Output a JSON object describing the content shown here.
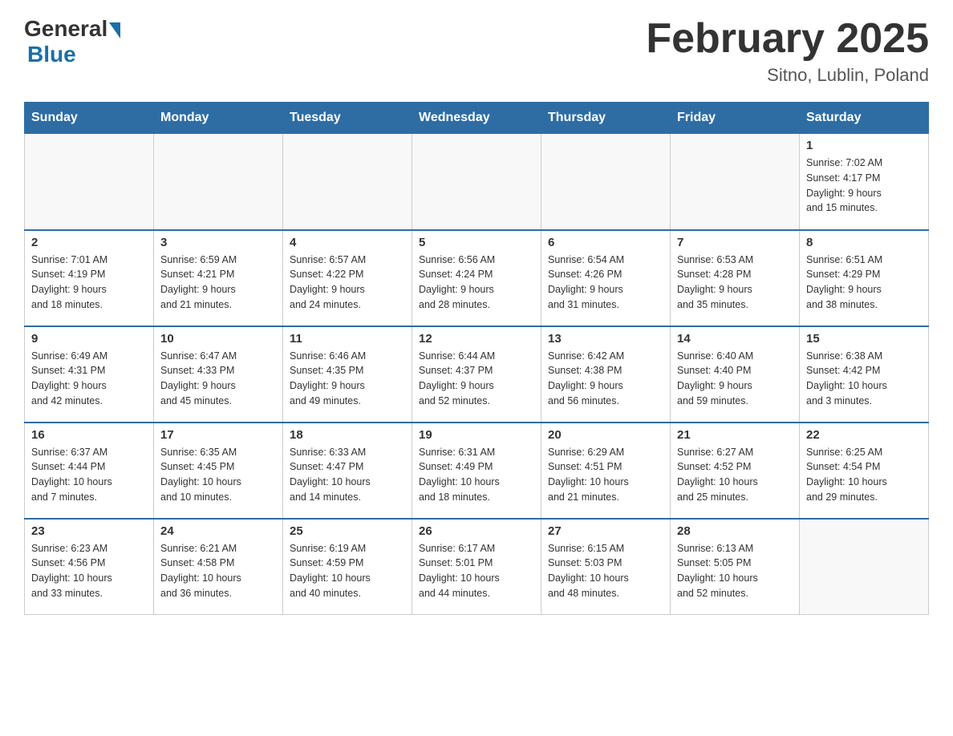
{
  "header": {
    "logo_general": "General",
    "logo_blue": "Blue",
    "title": "February 2025",
    "location": "Sitno, Lublin, Poland"
  },
  "weekdays": [
    "Sunday",
    "Monday",
    "Tuesday",
    "Wednesday",
    "Thursday",
    "Friday",
    "Saturday"
  ],
  "weeks": [
    [
      {
        "day": "",
        "info": ""
      },
      {
        "day": "",
        "info": ""
      },
      {
        "day": "",
        "info": ""
      },
      {
        "day": "",
        "info": ""
      },
      {
        "day": "",
        "info": ""
      },
      {
        "day": "",
        "info": ""
      },
      {
        "day": "1",
        "info": "Sunrise: 7:02 AM\nSunset: 4:17 PM\nDaylight: 9 hours\nand 15 minutes."
      }
    ],
    [
      {
        "day": "2",
        "info": "Sunrise: 7:01 AM\nSunset: 4:19 PM\nDaylight: 9 hours\nand 18 minutes."
      },
      {
        "day": "3",
        "info": "Sunrise: 6:59 AM\nSunset: 4:21 PM\nDaylight: 9 hours\nand 21 minutes."
      },
      {
        "day": "4",
        "info": "Sunrise: 6:57 AM\nSunset: 4:22 PM\nDaylight: 9 hours\nand 24 minutes."
      },
      {
        "day": "5",
        "info": "Sunrise: 6:56 AM\nSunset: 4:24 PM\nDaylight: 9 hours\nand 28 minutes."
      },
      {
        "day": "6",
        "info": "Sunrise: 6:54 AM\nSunset: 4:26 PM\nDaylight: 9 hours\nand 31 minutes."
      },
      {
        "day": "7",
        "info": "Sunrise: 6:53 AM\nSunset: 4:28 PM\nDaylight: 9 hours\nand 35 minutes."
      },
      {
        "day": "8",
        "info": "Sunrise: 6:51 AM\nSunset: 4:29 PM\nDaylight: 9 hours\nand 38 minutes."
      }
    ],
    [
      {
        "day": "9",
        "info": "Sunrise: 6:49 AM\nSunset: 4:31 PM\nDaylight: 9 hours\nand 42 minutes."
      },
      {
        "day": "10",
        "info": "Sunrise: 6:47 AM\nSunset: 4:33 PM\nDaylight: 9 hours\nand 45 minutes."
      },
      {
        "day": "11",
        "info": "Sunrise: 6:46 AM\nSunset: 4:35 PM\nDaylight: 9 hours\nand 49 minutes."
      },
      {
        "day": "12",
        "info": "Sunrise: 6:44 AM\nSunset: 4:37 PM\nDaylight: 9 hours\nand 52 minutes."
      },
      {
        "day": "13",
        "info": "Sunrise: 6:42 AM\nSunset: 4:38 PM\nDaylight: 9 hours\nand 56 minutes."
      },
      {
        "day": "14",
        "info": "Sunrise: 6:40 AM\nSunset: 4:40 PM\nDaylight: 9 hours\nand 59 minutes."
      },
      {
        "day": "15",
        "info": "Sunrise: 6:38 AM\nSunset: 4:42 PM\nDaylight: 10 hours\nand 3 minutes."
      }
    ],
    [
      {
        "day": "16",
        "info": "Sunrise: 6:37 AM\nSunset: 4:44 PM\nDaylight: 10 hours\nand 7 minutes."
      },
      {
        "day": "17",
        "info": "Sunrise: 6:35 AM\nSunset: 4:45 PM\nDaylight: 10 hours\nand 10 minutes."
      },
      {
        "day": "18",
        "info": "Sunrise: 6:33 AM\nSunset: 4:47 PM\nDaylight: 10 hours\nand 14 minutes."
      },
      {
        "day": "19",
        "info": "Sunrise: 6:31 AM\nSunset: 4:49 PM\nDaylight: 10 hours\nand 18 minutes."
      },
      {
        "day": "20",
        "info": "Sunrise: 6:29 AM\nSunset: 4:51 PM\nDaylight: 10 hours\nand 21 minutes."
      },
      {
        "day": "21",
        "info": "Sunrise: 6:27 AM\nSunset: 4:52 PM\nDaylight: 10 hours\nand 25 minutes."
      },
      {
        "day": "22",
        "info": "Sunrise: 6:25 AM\nSunset: 4:54 PM\nDaylight: 10 hours\nand 29 minutes."
      }
    ],
    [
      {
        "day": "23",
        "info": "Sunrise: 6:23 AM\nSunset: 4:56 PM\nDaylight: 10 hours\nand 33 minutes."
      },
      {
        "day": "24",
        "info": "Sunrise: 6:21 AM\nSunset: 4:58 PM\nDaylight: 10 hours\nand 36 minutes."
      },
      {
        "day": "25",
        "info": "Sunrise: 6:19 AM\nSunset: 4:59 PM\nDaylight: 10 hours\nand 40 minutes."
      },
      {
        "day": "26",
        "info": "Sunrise: 6:17 AM\nSunset: 5:01 PM\nDaylight: 10 hours\nand 44 minutes."
      },
      {
        "day": "27",
        "info": "Sunrise: 6:15 AM\nSunset: 5:03 PM\nDaylight: 10 hours\nand 48 minutes."
      },
      {
        "day": "28",
        "info": "Sunrise: 6:13 AM\nSunset: 5:05 PM\nDaylight: 10 hours\nand 52 minutes."
      },
      {
        "day": "",
        "info": ""
      }
    ]
  ]
}
